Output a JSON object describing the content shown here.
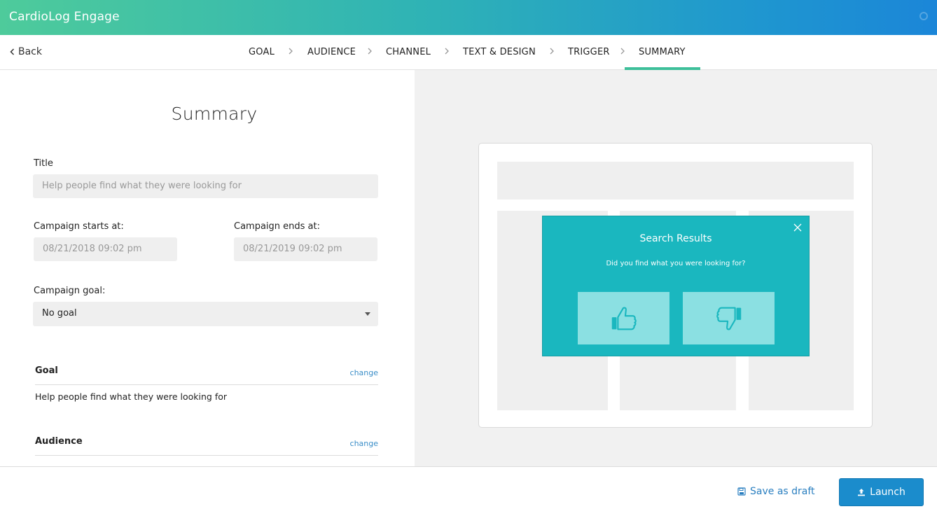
{
  "app": {
    "title": "CardioLog Engage"
  },
  "nav": {
    "back_label": "Back",
    "steps": [
      "GOAL",
      "AUDIENCE",
      "CHANNEL",
      "TEXT & DESIGN",
      "TRIGGER",
      "SUMMARY"
    ],
    "active_step": "SUMMARY"
  },
  "summary": {
    "heading": "Summary",
    "title_label": "Title",
    "title_placeholder": "Help people find what they were looking for",
    "start_label": "Campaign starts at:",
    "start_value": "08/21/2018 09:02 pm",
    "end_label": "Campaign ends at:",
    "end_value": "08/21/2019 09:02 pm",
    "goal_select_label": "Campaign goal:",
    "goal_select_value": "No goal",
    "sections": [
      {
        "heading": "Goal",
        "change_label": "change",
        "body": "Help people find what they were looking for"
      },
      {
        "heading": "Audience",
        "change_label": "change"
      }
    ]
  },
  "preview": {
    "popup_title": "Search Results",
    "popup_question": "Did you find what you were looking for?",
    "thumbs_up_icon": "thumbs-up-icon",
    "thumbs_down_icon": "thumbs-down-icon",
    "popup_color": "#1ab7bf"
  },
  "footer": {
    "save_draft_label": "Save as draft",
    "launch_label": "Launch"
  },
  "colors": {
    "accent_green": "#3dbf9a",
    "primary_blue": "#1b8ccc",
    "link_blue": "#3a8ec8"
  }
}
